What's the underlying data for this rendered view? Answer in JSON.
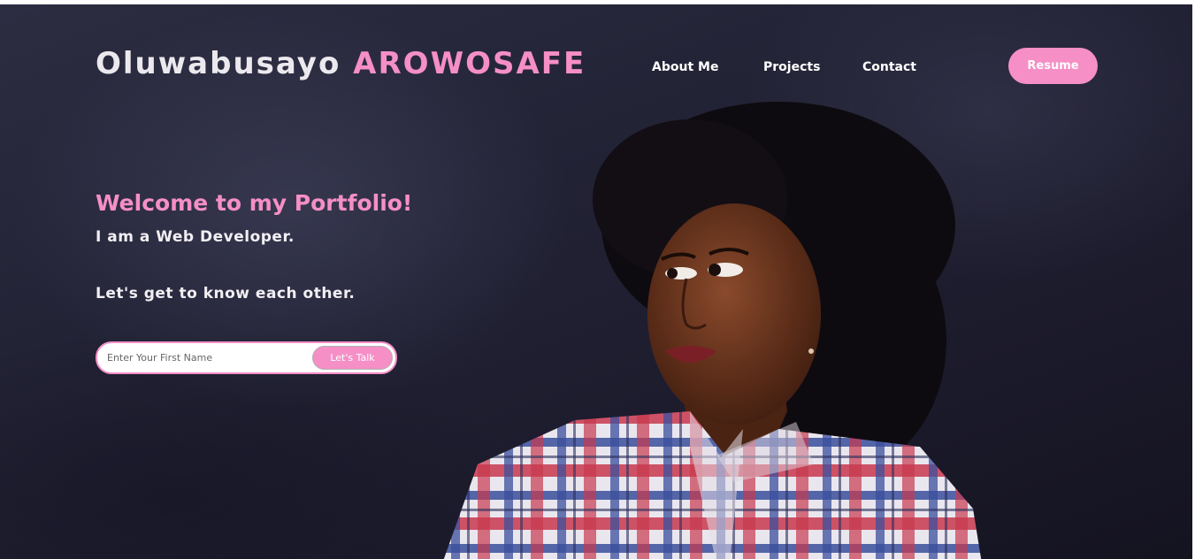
{
  "header": {
    "brand_first": "Oluwabusayo",
    "brand_last": "AROWOSAFE",
    "nav": {
      "about": "About Me",
      "projects": "Projects",
      "contact": "Contact"
    },
    "resume_label": "Resume"
  },
  "hero": {
    "welcome": "Welcome to my Portfolio!",
    "line1": "I am a Web Developer.",
    "line2": "Let's get to know each other.",
    "form": {
      "placeholder": "Enter Your First Name",
      "value": "",
      "button_label": "Let's Talk"
    }
  },
  "colors": {
    "accent": "#f58fc6",
    "background": "#1e1d2e",
    "text": "#ffffff"
  },
  "icons": {
    "portrait": "portrait-photo"
  }
}
